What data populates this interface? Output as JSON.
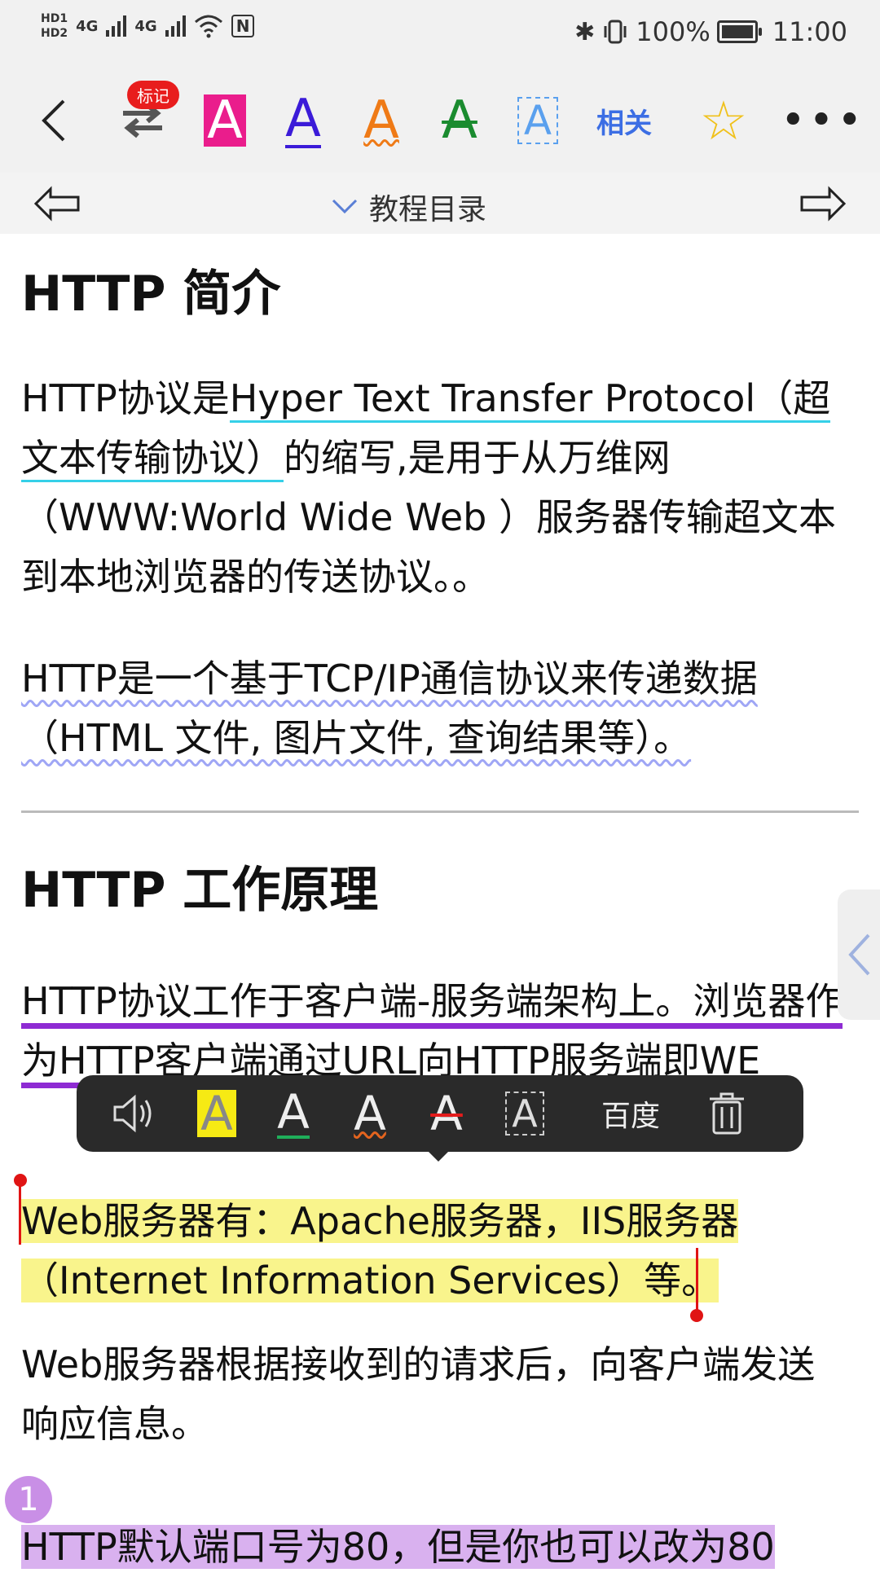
{
  "status_bar": {
    "hd1": "HD1",
    "hd2": "HD2",
    "net1": "4G",
    "net2": "4G",
    "nfc": "N",
    "battery_percent": "100%",
    "time": "11:00",
    "icons": [
      "bluetooth-icon",
      "vibrate-icon",
      "wifi-icon",
      "nfc-icon",
      "battery-icon"
    ]
  },
  "toolbar": {
    "badge": "标记",
    "related_label": "相关",
    "colors": {
      "highlight": "#ea1d8c",
      "underline": "#3b1bd8",
      "wavy": "#ef7a16",
      "strike": "#1a8b2f",
      "box": "#5aa0ee",
      "related": "#3c6ee4",
      "star": "#f0c11b"
    }
  },
  "nav": {
    "title": "教程目录"
  },
  "content": {
    "h1": "HTTP 简介",
    "p1_a": "HTTP协议是",
    "p1_link": "Hyper Text Transfer Protocol",
    "p1_link2": "（超文本传输协议）",
    "p1_b": "的缩写,是用于从万维网（WWW:World Wide Web ）服务器传输超文本到本地浏览器的传送协议。。",
    "p2": "HTTP是一个基于TCP/IP通信协议来传递数据（HTML 文件, 图片文件, 查询结果等）。",
    "h2": "HTTP 工作原理",
    "p3": "HTTP协议工作于客户端-服务端架构上。浏览器作为HTTP客户端通过URL向HTTP服务端即WE",
    "p4": "Web服务器有：Apache服务器，IIS服务器（Internet Information Services）等。",
    "p5": "Web服务器根据接收到的请求后，向客户端发送响应信息。",
    "p6": "HTTP默认端口号为80，但是你也可以改为80",
    "marker_number": "1"
  },
  "popup": {
    "search_label": "百度",
    "colors": {
      "highlight": "#f6ea14",
      "underline": "#1fae5a",
      "wavy": "#e4641e",
      "strike": "#e31b1b"
    }
  }
}
